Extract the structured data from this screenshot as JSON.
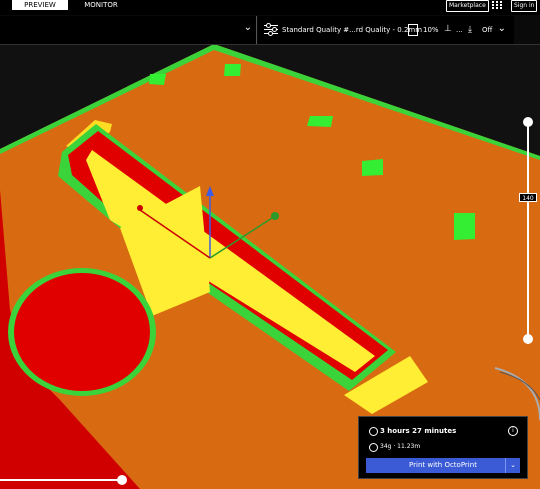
{
  "tabs": {
    "preview": "PREVIEW",
    "monitor": "MONITOR"
  },
  "topbar": {
    "marketplace": "Marketplace",
    "signin": "Sign in"
  },
  "print_settings": {
    "profile": "Standard Quality #...rd Quality - 0.2mm",
    "infill": "10%",
    "support": "...",
    "adhesion": "Off"
  },
  "layer_slider": {
    "current_layer": "140"
  },
  "job": {
    "duration": "3 hours 27 minutes",
    "material": "34g · 11.23m",
    "print_button": "Print with OctoPrint"
  }
}
